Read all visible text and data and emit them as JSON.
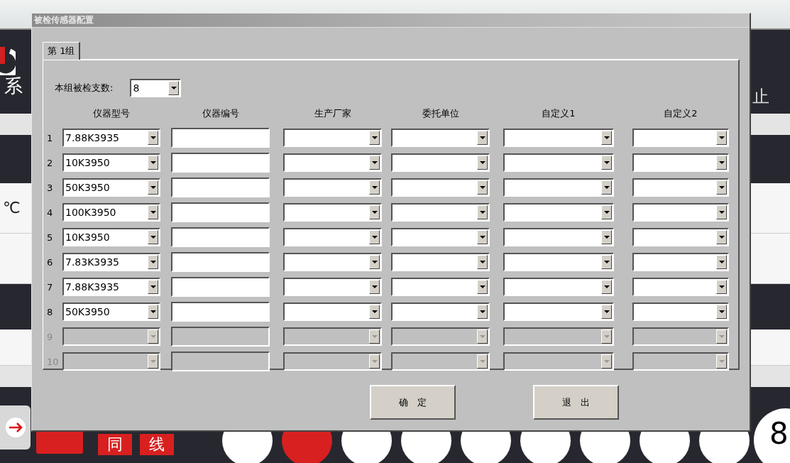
{
  "background": {
    "title_fragment": "系",
    "right_fragment": "止",
    "unit": "℃",
    "red_buttons": [
      "同",
      "线"
    ],
    "counter": "8"
  },
  "window": {
    "title": "被检传感器配置"
  },
  "tabs": [
    {
      "label": "第 1组",
      "selected": true
    }
  ],
  "count": {
    "label": "本组被检支数:",
    "value": "8"
  },
  "columns": [
    "仪器型号",
    "仪器编号",
    "生产厂家",
    "委托单位",
    "自定义1",
    "自定义2"
  ],
  "rows": [
    {
      "index": "1",
      "model": "7.88K3935",
      "disabled": false
    },
    {
      "index": "2",
      "model": "10K3950",
      "disabled": false
    },
    {
      "index": "3",
      "model": "50K3950",
      "disabled": false
    },
    {
      "index": "4",
      "model": "100K3950",
      "disabled": false
    },
    {
      "index": "5",
      "model": "10K3950",
      "disabled": false
    },
    {
      "index": "6",
      "model": "7.83K3935",
      "disabled": false
    },
    {
      "index": "7",
      "model": "7.88K3935",
      "disabled": false
    },
    {
      "index": "8",
      "model": "50K3950",
      "disabled": false
    },
    {
      "index": "9",
      "model": "",
      "disabled": true
    },
    {
      "index": "10",
      "model": "",
      "disabled": true
    }
  ],
  "buttons": [
    "确　定",
    "退　出"
  ]
}
